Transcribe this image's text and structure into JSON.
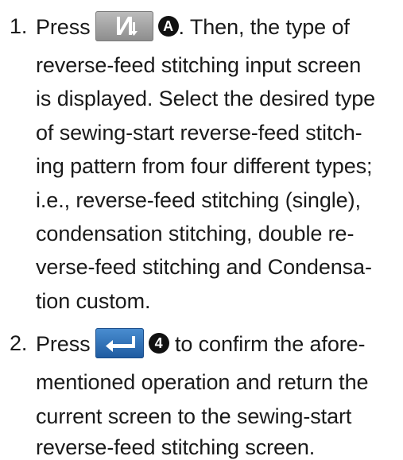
{
  "step1": {
    "number": "1.",
    "press_label": "Press",
    "marker": "A",
    "lines": [
      ". Then, the type of",
      "reverse-feed stitching input screen",
      "is displayed. Select the desired type",
      "of sewing-start reverse-feed stitch-",
      "ing pattern from four different types;",
      "i.e., reverse-feed stitching (single),",
      "condensation stitching, double re-",
      "verse-feed stitching and Condensa-",
      "tion custom."
    ],
    "icon": "reverse-feed-type-key-icon"
  },
  "step2": {
    "number": "2.",
    "press_label": "Press",
    "marker": "4",
    "lines": [
      "to confirm the afore-",
      "mentioned operation and return the",
      "current screen to the sewing-start",
      "reverse-feed stitching screen."
    ],
    "icon": "enter-key-icon"
  },
  "colors": {
    "text": "#1a1a1a",
    "gray_key": "#9e9e9e",
    "blue_key": "#2a6bb5",
    "marker_bg": "#111111"
  }
}
